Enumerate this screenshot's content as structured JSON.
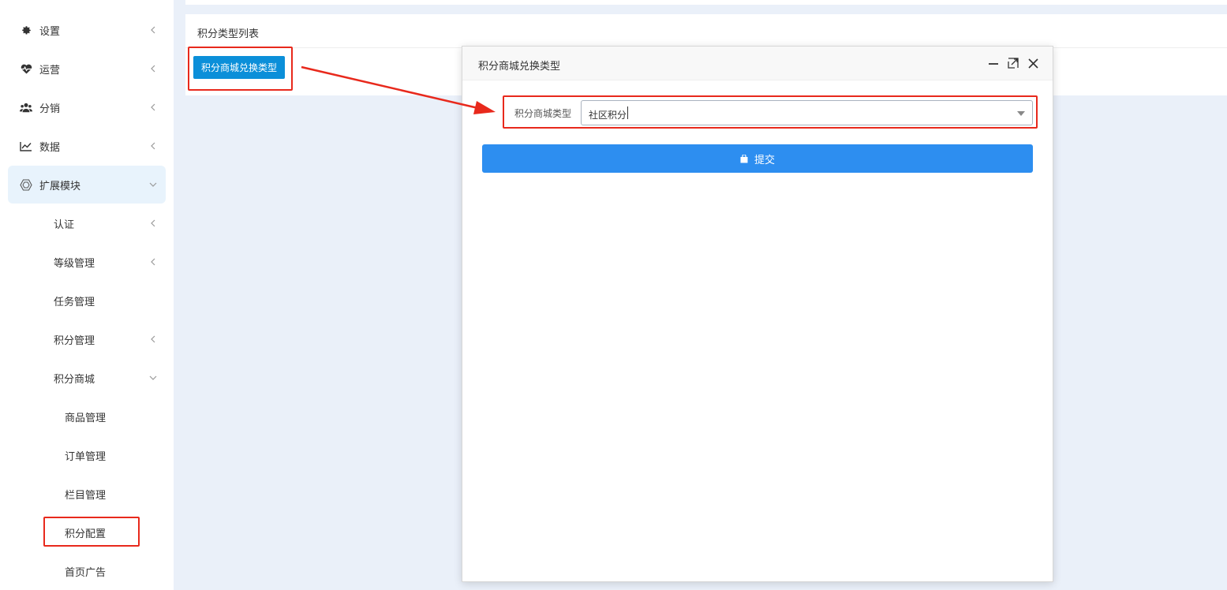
{
  "sidebar": {
    "items": [
      {
        "label": "设置",
        "icon": "gear-icon"
      },
      {
        "label": "运营",
        "icon": "heartbeat-icon"
      },
      {
        "label": "分销",
        "icon": "users-icon"
      },
      {
        "label": "数据",
        "icon": "line-chart-icon"
      },
      {
        "label": "扩展模块",
        "icon": "hexagon-icon"
      }
    ],
    "sub_items": [
      {
        "label": "认证"
      },
      {
        "label": "等级管理"
      },
      {
        "label": "任务管理"
      },
      {
        "label": "积分管理"
      },
      {
        "label": "积分商城"
      }
    ],
    "sub_sub_items": [
      {
        "label": "商品管理"
      },
      {
        "label": "订单管理"
      },
      {
        "label": "栏目管理"
      },
      {
        "label": "积分配置"
      },
      {
        "label": "首页广告"
      }
    ]
  },
  "panel": {
    "title": "积分类型列表",
    "add_button": "积分商城兑换类型"
  },
  "modal": {
    "title": "积分商城兑换类型",
    "field_label": "积分商城类型",
    "field_value": "社区积分",
    "submit_label": "提交"
  },
  "colors": {
    "highlight": "#e8291c",
    "primary": "#2d8ef0",
    "button": "#0b8fd9",
    "active_bg": "#e8f3fc"
  }
}
